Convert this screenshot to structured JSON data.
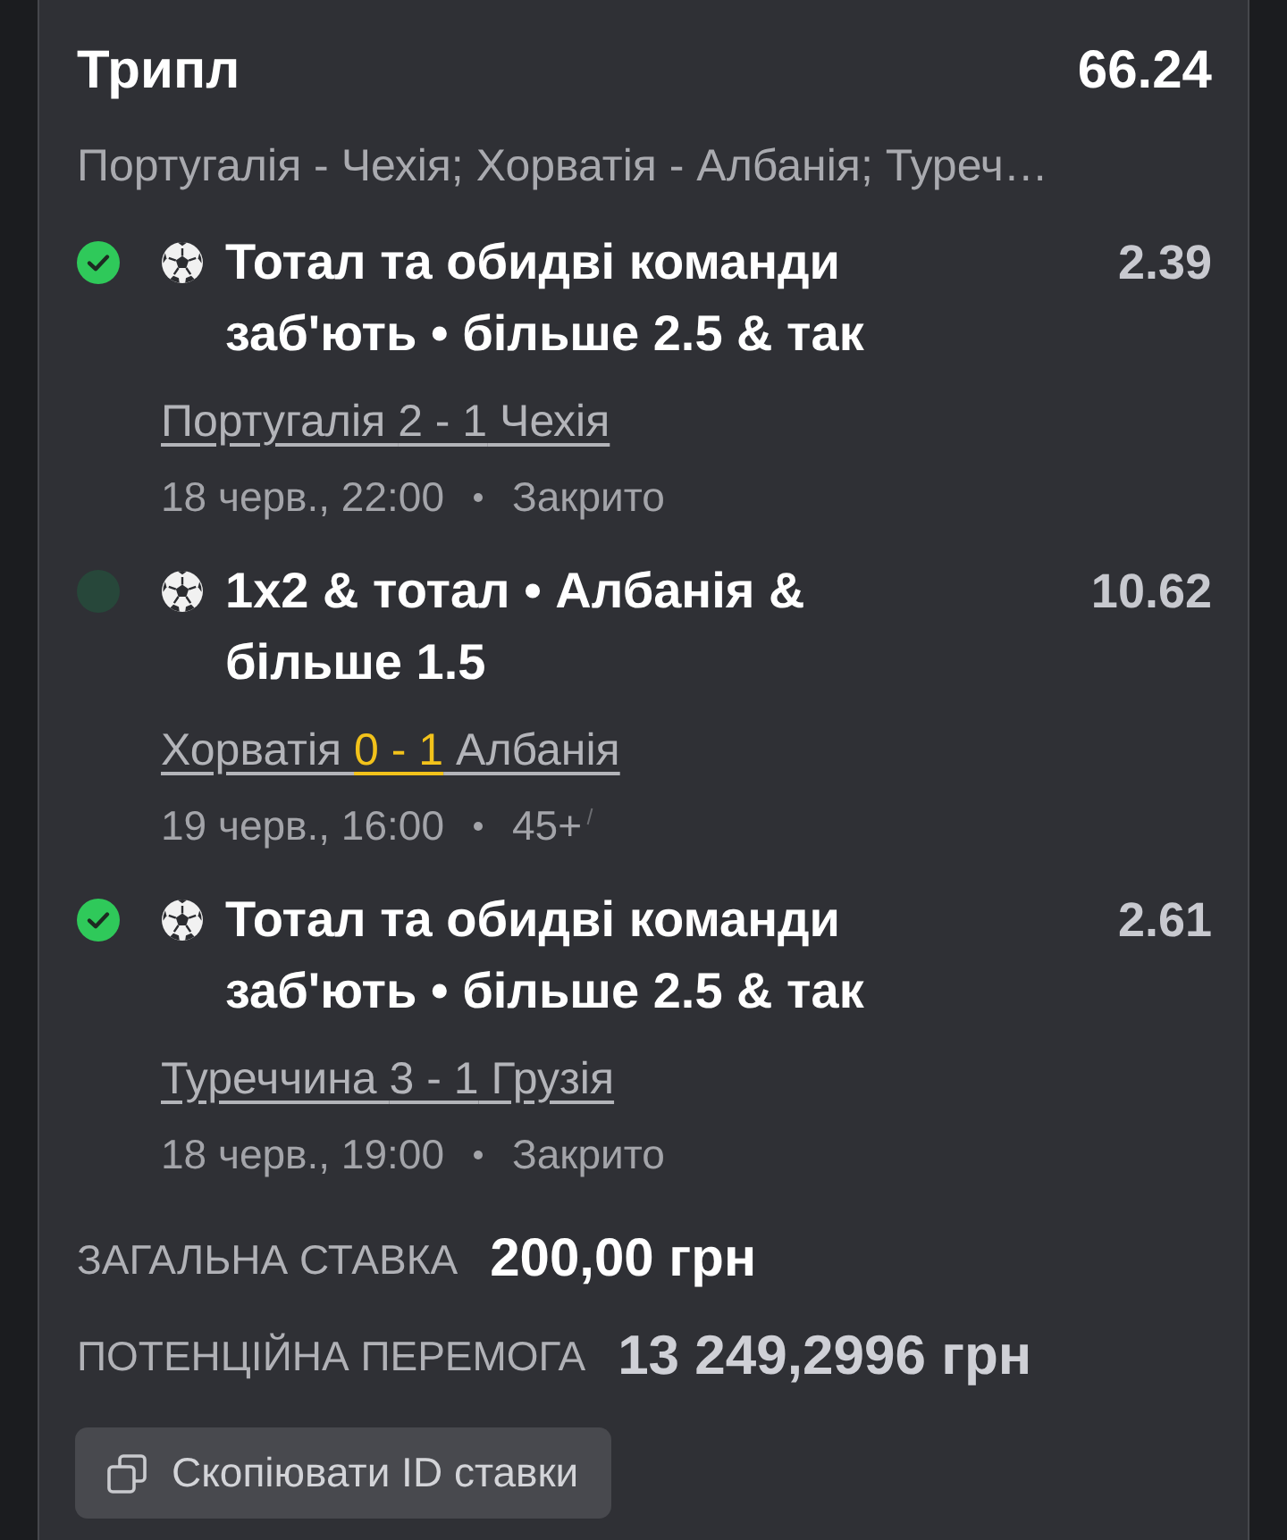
{
  "bet_slip": {
    "title": "Трипл",
    "total_odds": "66.24",
    "events_summary": "Португалія - Чехія; Хорватія - Албанія; Туреч…"
  },
  "selections": [
    {
      "won": true,
      "bet": "Тотал та обидві команди заб'ють • більше 2.5 & так",
      "odds": "2.39",
      "home": "Португалія",
      "score": "2 - 1",
      "away": "Чехія",
      "live": false,
      "date": "18 черв., 22:00",
      "state": "Закрито"
    },
    {
      "won": false,
      "bet": "1x2 & тотал • Албанія & більше 1.5",
      "odds": "10.62",
      "home": "Хорватія",
      "score": "0 - 1",
      "away": "Албанія",
      "live": true,
      "date": "19 черв., 16:00",
      "state": "45+"
    },
    {
      "won": true,
      "bet": "Тотал та обидві команди заб'ють • більше 2.5 & так",
      "odds": "2.61",
      "home": "Туреччина",
      "score": "3 - 1",
      "away": "Грузія",
      "live": false,
      "date": "18 черв., 19:00",
      "state": "Закрито"
    }
  ],
  "totals": [
    {
      "kind": "stake",
      "label": "ЗАГАЛЬНА СТАВКА",
      "value": "200,00 грн"
    },
    {
      "kind": "payout",
      "label": "ПОТЕНЦІЙНА ПЕРЕМОГА",
      "value": "13 249,2996 грн"
    }
  ],
  "copy_button": {
    "label": "Скопіювати ID ставки"
  }
}
